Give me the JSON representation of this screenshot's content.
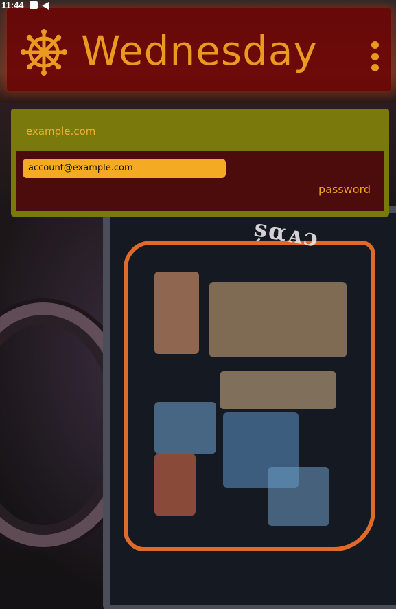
{
  "status_bar": {
    "time": "11:44",
    "icons": [
      "image-icon",
      "telegram-icon"
    ]
  },
  "app_bar": {
    "title": "Wednesday",
    "logo_icon": "ship-wheel-icon",
    "menu_icon": "more-vert-icon",
    "background_color": "#6e0505",
    "accent_color": "#ea9a1e"
  },
  "credential_card": {
    "site": "example.com",
    "account": "account@example.com",
    "password_label": "password",
    "frame_color": "#7a7a0c",
    "body_color": "#4d0c0c",
    "field_color": "#f4aa22"
  }
}
